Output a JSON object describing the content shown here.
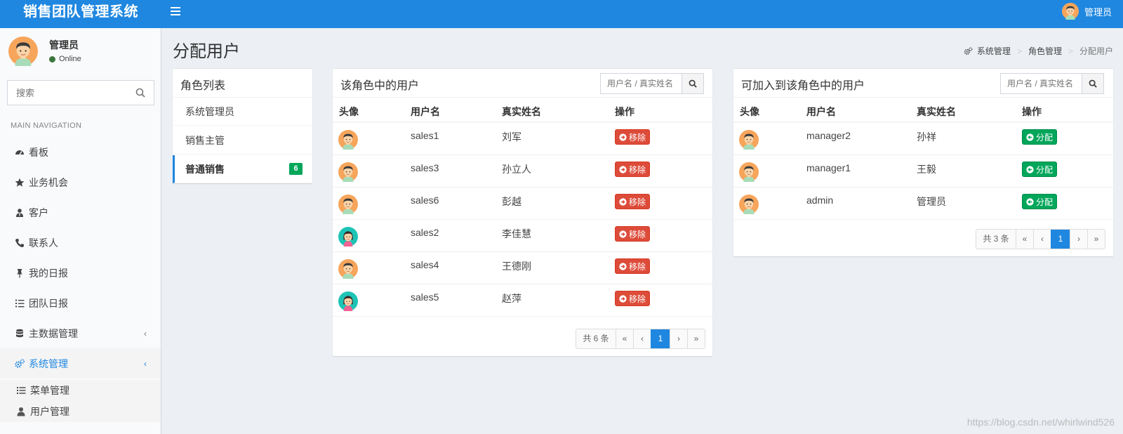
{
  "app": {
    "title": "销售团队管理系统",
    "user_name": "管理员"
  },
  "sidebar": {
    "user": {
      "name": "管理员",
      "status": "Online"
    },
    "search_placeholder": "搜索",
    "nav_header": "MAIN NAVIGATION",
    "items": [
      {
        "label": "看板",
        "icon": "dashboard-icon"
      },
      {
        "label": "业务机会",
        "icon": "star-icon"
      },
      {
        "label": "客户",
        "icon": "user-tie-icon"
      },
      {
        "label": "联系人",
        "icon": "phone-icon"
      },
      {
        "label": "我的日报",
        "icon": "pin-icon"
      },
      {
        "label": "团队日报",
        "icon": "list-ol-icon"
      },
      {
        "label": "主数据管理",
        "icon": "database-icon"
      },
      {
        "label": "系统管理",
        "icon": "gears-icon"
      }
    ],
    "sub_items": [
      {
        "label": "菜单管理",
        "icon": "list-icon"
      },
      {
        "label": "用户管理",
        "icon": "user-icon"
      }
    ]
  },
  "page": {
    "title": "分配用户"
  },
  "breadcrumb": [
    "系统管理",
    "角色管理",
    "分配用户"
  ],
  "roles": {
    "title": "角色列表",
    "items": [
      {
        "label": "系统管理员"
      },
      {
        "label": "销售主管"
      },
      {
        "label": "普通销售",
        "badge": "6",
        "active": true
      }
    ]
  },
  "in_role": {
    "title": "该角色中的用户",
    "search_placeholder": "用户名 / 真实姓名",
    "columns": [
      "头像",
      "用户名",
      "真实姓名",
      "操作"
    ],
    "action_label": "移除",
    "rows": [
      {
        "username": "sales1",
        "realname": "刘军",
        "avatar": "male"
      },
      {
        "username": "sales3",
        "realname": "孙立人",
        "avatar": "male"
      },
      {
        "username": "sales6",
        "realname": "彭越",
        "avatar": "male"
      },
      {
        "username": "sales2",
        "realname": "李佳慧",
        "avatar": "female"
      },
      {
        "username": "sales4",
        "realname": "王德刚",
        "avatar": "male"
      },
      {
        "username": "sales5",
        "realname": "赵萍",
        "avatar": "female"
      }
    ],
    "pager": {
      "total": "共 6 条",
      "first": "«",
      "prev": "‹",
      "current": "1",
      "next": "›",
      "last": "»"
    }
  },
  "available": {
    "title": "可加入到该角色中的用户",
    "search_placeholder": "用户名 / 真实姓名",
    "columns": [
      "头像",
      "用户名",
      "真实姓名",
      "操作"
    ],
    "action_label": "分配",
    "rows": [
      {
        "username": "manager2",
        "realname": "孙祥",
        "avatar": "male"
      },
      {
        "username": "manager1",
        "realname": "王毅",
        "avatar": "male"
      },
      {
        "username": "admin",
        "realname": "管理员",
        "avatar": "male"
      }
    ],
    "pager": {
      "total": "共 3 条",
      "first": "«",
      "prev": "‹",
      "current": "1",
      "next": "›",
      "last": "»"
    }
  },
  "watermark": "https://blog.csdn.net/whirlwind526",
  "colors": {
    "primary": "#1f87e0",
    "danger": "#dd4b39",
    "success": "#00a65a"
  }
}
